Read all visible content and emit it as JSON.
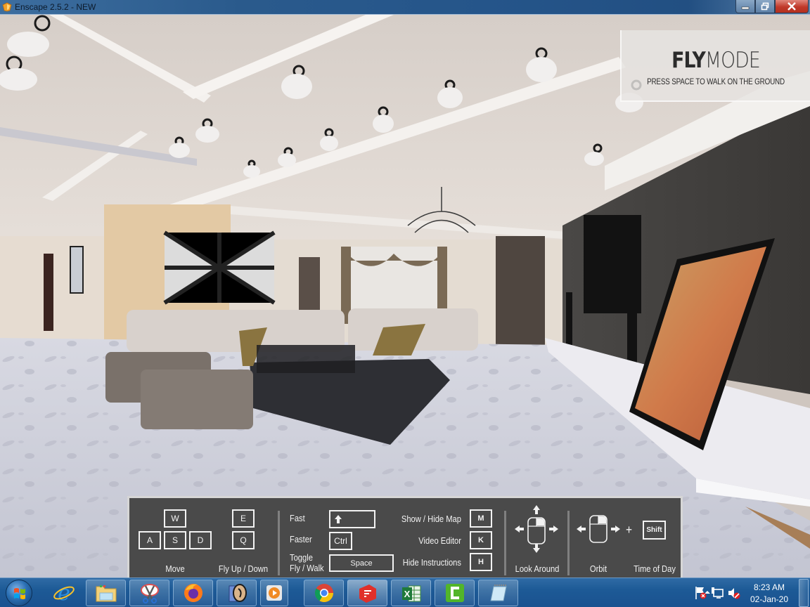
{
  "window": {
    "title": "Enscape 2.5.2 - NEW",
    "controls": {
      "minimize": "minimize",
      "restore": "restore",
      "close": "close"
    }
  },
  "overlay": {
    "mode_bold": "FLY",
    "mode_light": "MODE",
    "hint": "PRESS SPACE TO WALK ON THE GROUND"
  },
  "instructions": {
    "move": {
      "keys": [
        "W",
        "A",
        "S",
        "D"
      ],
      "label": "Move"
    },
    "fly_up_down": {
      "keys": [
        "E",
        "Q"
      ],
      "label": "Fly Up / Down"
    },
    "fast": {
      "label": "Fast",
      "key_icon": "shift-arrow-icon"
    },
    "faster": {
      "label": "Faster",
      "key": "Ctrl"
    },
    "toggle": {
      "label_line1": "Toggle",
      "label_line2": "Fly / Walk",
      "key": "Space"
    },
    "show_hide_map": {
      "label": "Show / Hide Map",
      "key": "M"
    },
    "video_editor": {
      "label": "Video Editor",
      "key": "K"
    },
    "hide_instructions": {
      "label": "Hide Instructions",
      "key": "H"
    },
    "look_around": {
      "label": "Look Around"
    },
    "orbit": {
      "label": "Orbit",
      "plus": "+"
    },
    "time_of_day": {
      "label": "Time of Day",
      "key": "Shift"
    }
  },
  "taskbar": {
    "start": "start-button",
    "pinned": [
      {
        "name": "internet-explorer"
      },
      {
        "name": "file-explorer"
      },
      {
        "name": "snipping-tool"
      },
      {
        "name": "firefox"
      },
      {
        "name": "enscape"
      },
      {
        "name": "media-player"
      },
      {
        "name": "chrome"
      },
      {
        "name": "sketchup"
      },
      {
        "name": "excel"
      },
      {
        "name": "camtasia"
      },
      {
        "name": "notepad"
      }
    ],
    "tray": {
      "icons": [
        "show-hidden-icons",
        "action-center-flag",
        "network",
        "volume-muted"
      ],
      "time": "8:23 AM",
      "date": "02-Jan-20"
    }
  },
  "colors": {
    "titlebar": "#25558a",
    "close": "#c0392b",
    "panel": "#4a4a4a",
    "panel_border": "#d6d6d6",
    "taskbar": "#1d5a96"
  }
}
